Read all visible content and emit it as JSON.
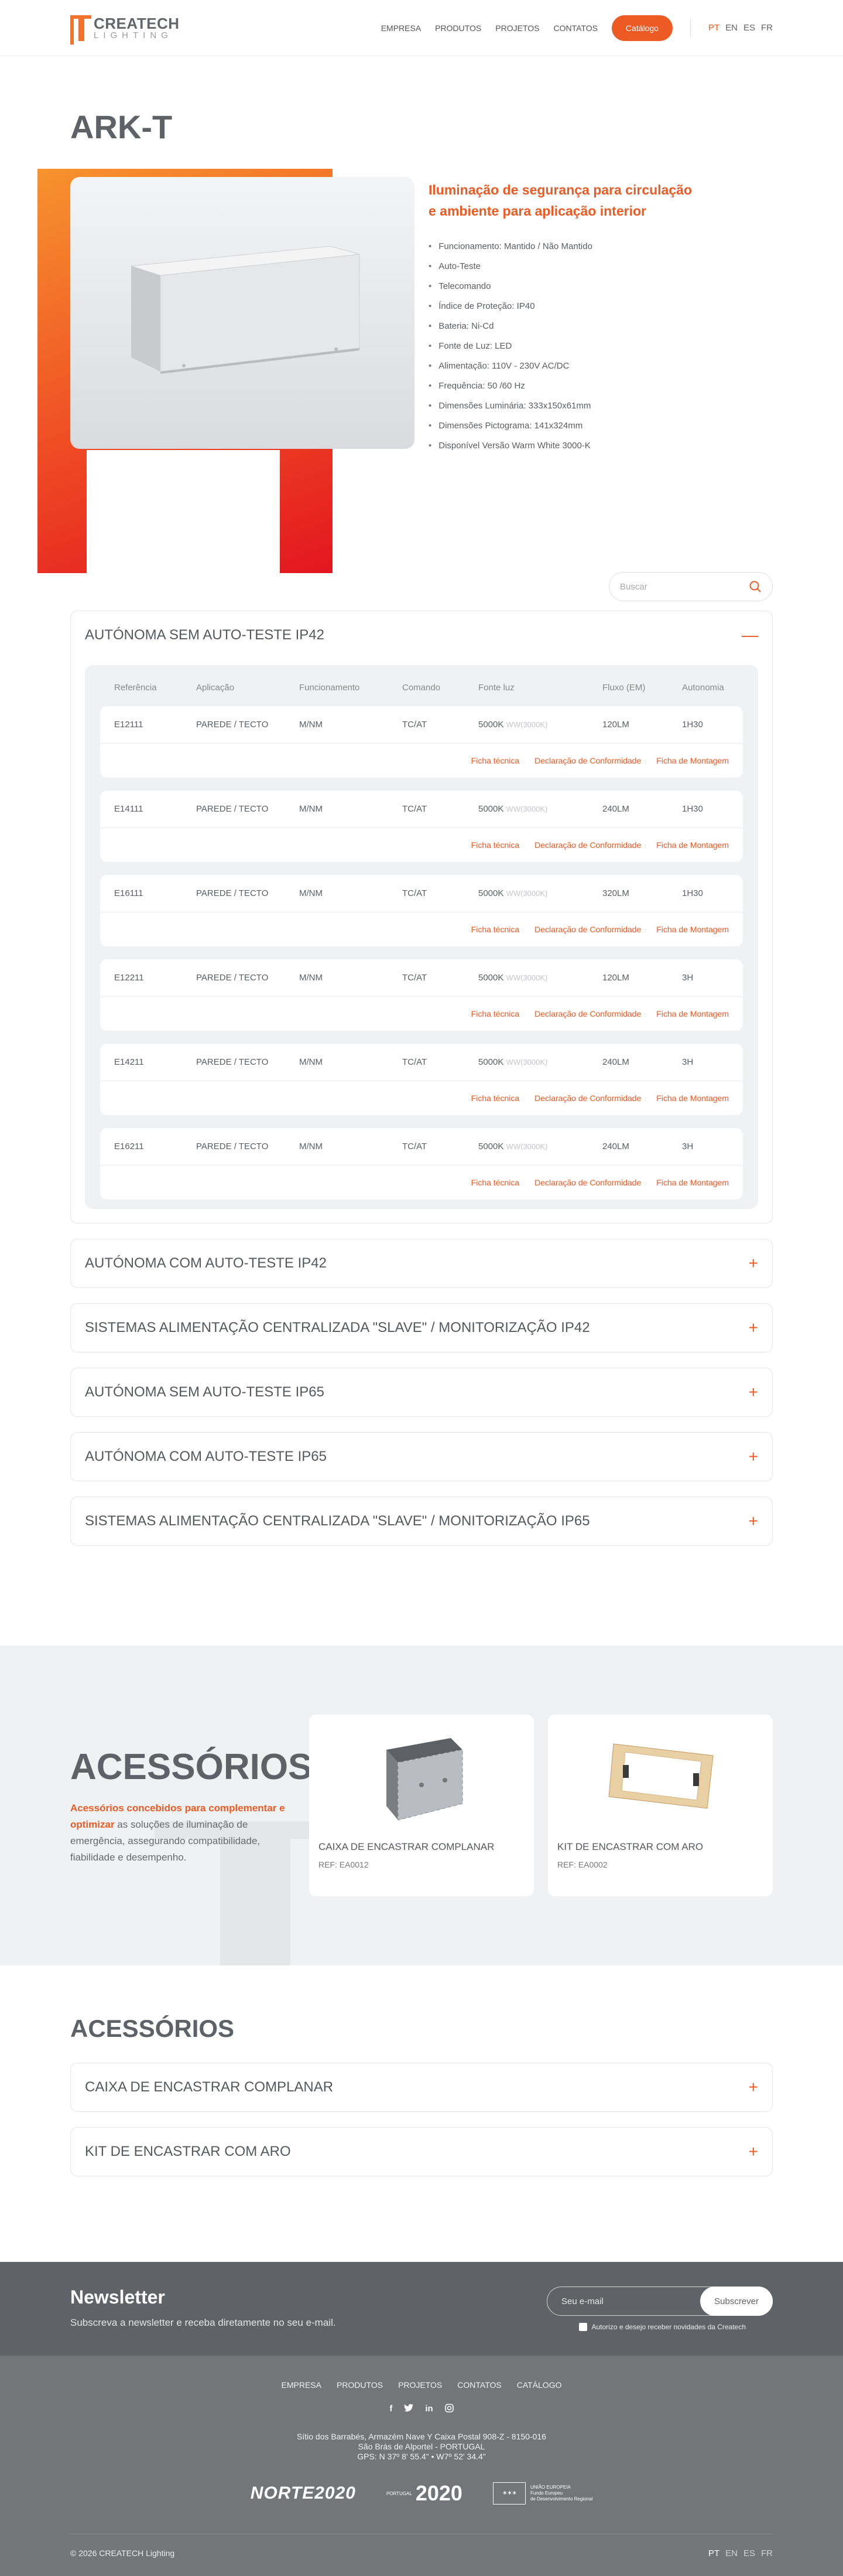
{
  "brand": {
    "name": "CREATECH",
    "sub": "LIGHTING"
  },
  "nav": {
    "links": [
      "EMPRESA",
      "PRODUTOS",
      "PROJETOS",
      "CONTATOS"
    ],
    "catalog": "Catálogo",
    "langs": [
      "PT",
      "EN",
      "ES",
      "FR"
    ],
    "active_lang": "PT"
  },
  "product": {
    "title": "ARK-T",
    "subtitle_1": "Iluminação de segurança para circulação",
    "subtitle_2": "e ambiente para aplicação interior",
    "specs": [
      "Funcionamento: Mantido / Não Mantido",
      "Auto-Teste",
      "Telecomando",
      "Índice de Proteção: IP40",
      "Bateria: Ni-Cd",
      "Fonte de Luz: LED",
      "Alimentação: 110V - 230V AC/DC",
      "Frequência: 50 /60 Hz",
      "Dimensões Luminária: 333x150x61mm",
      "Dimensões Pictograma: 141x324mm",
      "Disponível Versão Warm White 3000-K"
    ]
  },
  "search": {
    "placeholder": "Buscar"
  },
  "sections": {
    "open": {
      "title": "AUTÓNOMA SEM AUTO-TESTE IP42",
      "icon": "minus-icon",
      "headers": [
        "Referência",
        "Aplicação",
        "Funcionamento",
        "Comando",
        "Fonte luz",
        "Fluxo (EM)",
        "Autonomia"
      ],
      "rows": [
        {
          "ref": "E12111",
          "app": "PAREDE / TECTO",
          "func": "M/NM",
          "cmd": "TC/AT",
          "light": "5000K",
          "light_note": "WW(3000K)",
          "flux": "120LM",
          "auto": "1H30"
        },
        {
          "ref": "E14111",
          "app": "PAREDE / TECTO",
          "func": "M/NM",
          "cmd": "TC/AT",
          "light": "5000K",
          "light_note": "WW(3000K)",
          "flux": "240LM",
          "auto": "1H30"
        },
        {
          "ref": "E16111",
          "app": "PAREDE / TECTO",
          "func": "M/NM",
          "cmd": "TC/AT",
          "light": "5000K",
          "light_note": "WW(3000K)",
          "flux": "320LM",
          "auto": "1H30"
        },
        {
          "ref": "E12211",
          "app": "PAREDE / TECTO",
          "func": "M/NM",
          "cmd": "TC/AT",
          "light": "5000K",
          "light_note": "WW(3000K)",
          "flux": "120LM",
          "auto": "3H"
        },
        {
          "ref": "E14211",
          "app": "PAREDE / TECTO",
          "func": "M/NM",
          "cmd": "TC/AT",
          "light": "5000K",
          "light_note": "WW(3000K)",
          "flux": "240LM",
          "auto": "3H"
        },
        {
          "ref": "E16211",
          "app": "PAREDE / TECTO",
          "func": "M/NM",
          "cmd": "TC/AT",
          "light": "5000K",
          "light_note": "WW(3000K)",
          "flux": "240LM",
          "auto": "3H"
        }
      ],
      "links": [
        "Ficha técnica",
        "Declaração de Conformidade",
        "Ficha de Montagem"
      ]
    },
    "closed": [
      "AUTÓNOMA COM AUTO-TESTE IP42",
      "SISTEMAS ALIMENTAÇÃO CENTRALIZADA \"SLAVE\" / MONITORIZAÇÃO IP42",
      "AUTÓNOMA SEM AUTO-TESTE IP65",
      "AUTÓNOMA COM AUTO-TESTE IP65",
      "SISTEMAS ALIMENTAÇÃO CENTRALIZADA \"SLAVE\" / MONITORIZAÇÃO IP65"
    ]
  },
  "accessories": {
    "title": "ACESSÓRIOS",
    "desc_hl": "Acessórios concebidos para complementar e optimizar",
    "desc_rest": " as soluções de iluminação de emergência, assegurando compatibilidade, fiabilidade e desempenho.",
    "cards": [
      {
        "name": "CAIXA DE ENCASTRAR COMPLANAR",
        "ref": "REF: EA0012"
      },
      {
        "name": "KIT DE ENCASTRAR COM ARO",
        "ref": "REF: EA0002"
      }
    ],
    "list_title": "ACESSÓRIOS",
    "list": [
      "CAIXA DE ENCASTRAR COMPLANAR",
      "KIT DE ENCASTRAR COM ARO"
    ]
  },
  "newsletter": {
    "title": "Newsletter",
    "sub": "Subscreva a newsletter e receba diretamente no seu e-mail.",
    "placeholder": "Seu e-mail",
    "button": "Subscrever",
    "consent": "Autorizo e desejo receber novidades da Createch"
  },
  "footer": {
    "links": [
      "EMPRESA",
      "PRODUTOS",
      "PROJETOS",
      "CONTATOS",
      "CATÁLOGO"
    ],
    "social": [
      "facebook-icon",
      "twitter-icon",
      "linkedin-icon",
      "instagram-icon"
    ],
    "addr1": "Sítio dos Barrabés, Armazém Nave Y Caixa Postal 908-Z - 8150-016",
    "addr2": "São Brás de Alportel - PORTUGAL",
    "addr3": "GPS: N 37º 8' 55.4\" • W7º 52' 34.4\"",
    "logo_norte": "NORTE2020",
    "logo_pt_small": "PORTUGAL",
    "logo_pt_big": "2020",
    "logo_eu_1": "UNIÃO EUROPEIA",
    "logo_eu_2": "Fundo Europeu",
    "logo_eu_3": "de Desenvolvimento Regional",
    "copyright": "© 2026 CREATECH Lighting",
    "langs": [
      "PT",
      "EN",
      "ES",
      "FR"
    ]
  },
  "colors": {
    "accent": "#ee5a24",
    "text": "#5a5d62",
    "footer": "#737578",
    "newsletter": "#5f6266"
  }
}
